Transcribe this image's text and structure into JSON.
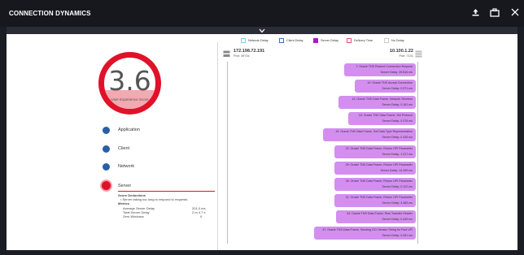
{
  "header": {
    "title": "CONNECTION DYNAMICS",
    "icons": [
      "upload-icon",
      "briefcase-icon",
      "close-icon"
    ]
  },
  "score": {
    "value": "3.6",
    "label": "User Experience Score",
    "fill_fraction": 0.36,
    "ring_color": "#e0122a",
    "fill_color": "#f2a9b2"
  },
  "dimensions": [
    {
      "label": "Application"
    },
    {
      "label": "Client"
    },
    {
      "label": "Network"
    }
  ],
  "server": {
    "label": "Server",
    "deductions_title": "Score Deductions",
    "deduction_item": "• Server taking too long to respond to requests",
    "metrics_title": "Metrics",
    "metrics": [
      {
        "name": "Average Server Delay",
        "value": "201.0 ms"
      },
      {
        "name": "Total Server Delay",
        "value": "2 m 4.7 s"
      },
      {
        "name": "Zero Windows",
        "value": "0"
      }
    ]
  },
  "legend": [
    {
      "label": "Network Delay",
      "color": "#7fd3d8"
    },
    {
      "label": "Client Delay",
      "color": "#3a6fc0"
    },
    {
      "label": "Server Delay",
      "color": "#a020c0"
    },
    {
      "label": "Delivery Time",
      "color": "#e0507a"
    },
    {
      "label": "No Delay",
      "color": "#cccccc"
    }
  ],
  "client": {
    "ip": "172.198.72.191",
    "port": "Port: 39734"
  },
  "host": {
    "ip": "10.100.1.22",
    "port": "Port: 7101"
  },
  "messages": [
    {
      "text": "7: Oracle TNS Resend Connection Request",
      "delay": "Server Delay: 39.816 ms"
    },
    {
      "text": "10: Oracle TNS Accept Connection",
      "delay": "Server Delay: 0.971 ms"
    },
    {
      "text": "13: Oracle TNS Data Frame, Network Services",
      "delay": "Server Delay: 0.161 ms"
    },
    {
      "text": "16: Oracle TNS Data Frame, Set Protocol",
      "delay": "Server Delay: 0.076 ms"
    },
    {
      "text": "19: Oracle TNS Data Frame, Set Data Type Representation",
      "delay": "Server Delay: 0.435 ms"
    },
    {
      "text": "22: Oracle TNS Data Frame, Return OPI Parameter",
      "delay": "Server Delay: 1.217 ms"
    },
    {
      "text": "25: Oracle TNS Data Frame, Return OPI Parameter",
      "delay": "Server Delay: 14.399 ms"
    },
    {
      "text": "28: Oracle TNS Data Frame, Return OPI Parameter",
      "delay": "Server Delay: 0.122 ms"
    },
    {
      "text": "31: Oracle TNS Data Frame, Return OPI Parameter",
      "delay": "Server Delay: 3.489 ms"
    },
    {
      "text": "34: Oracle TNS Data Frame, Row Transfer Header",
      "delay": "Server Delay: 0.449 ms"
    },
    {
      "text": "37: Oracle TNS Data Frame, Sending OCI Version String for Fast UPI",
      "delay": "Server Delay: 0.061 ms"
    }
  ]
}
